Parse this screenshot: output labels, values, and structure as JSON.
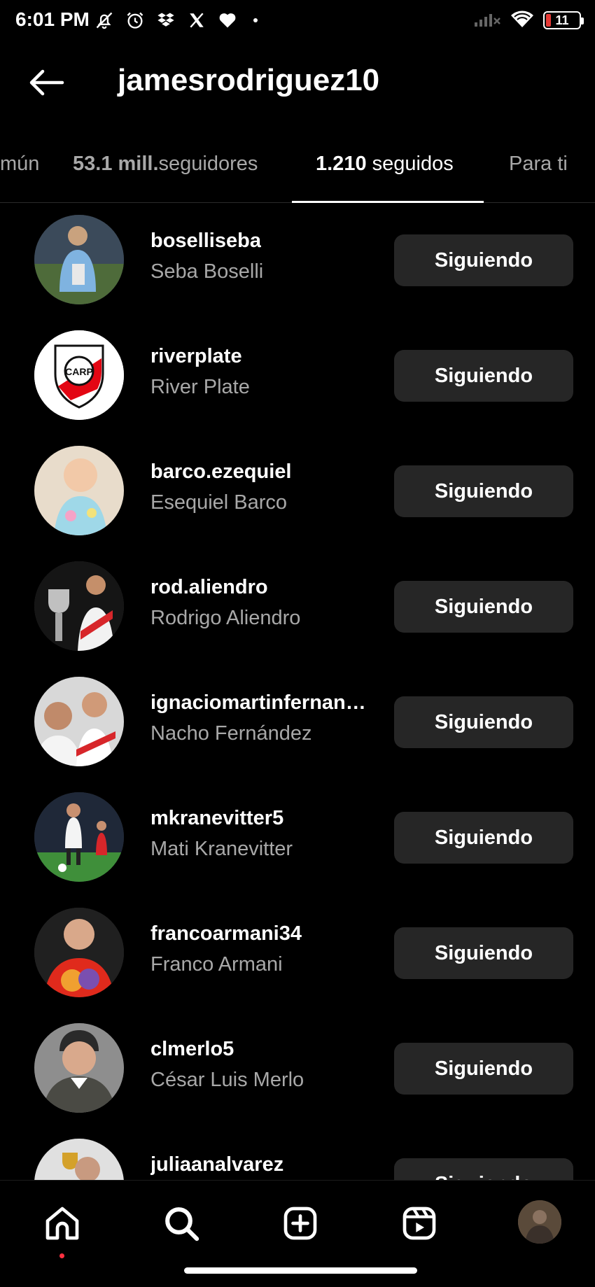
{
  "status_bar": {
    "time": "6:01 PM",
    "left_icons": [
      "mute-bell-icon",
      "alarm-icon",
      "dropbox-icon",
      "x-icon",
      "heart-icon"
    ],
    "battery": "11",
    "battery_color": "#e53935"
  },
  "header": {
    "back_icon": "arrow-left-icon",
    "title": "jamesrodriguez10"
  },
  "tabs": [
    {
      "label": "mún",
      "active": false
    },
    {
      "count": "53.1 mill.",
      "label": "seguidores",
      "active": false
    },
    {
      "count": "1.210",
      "label": "seguidos",
      "active": true
    },
    {
      "label": "Para ti",
      "active": false
    }
  ],
  "accounts": [
    {
      "username": "boselliseba",
      "fullname": "Seba Boselli",
      "button": "Siguiendo"
    },
    {
      "username": "riverplate",
      "fullname": "River Plate",
      "button": "Siguiendo"
    },
    {
      "username": "barco.ezequiel",
      "fullname": "Esequiel Barco",
      "button": "Siguiendo"
    },
    {
      "username": "rod.aliendro",
      "fullname": "Rodrigo Aliendro",
      "button": "Siguiendo"
    },
    {
      "username": "ignaciomartinfernan…",
      "fullname": "Nacho Fernández",
      "button": "Siguiendo"
    },
    {
      "username": "mkranevitter5",
      "fullname": "Mati Kranevitter",
      "button": "Siguiendo"
    },
    {
      "username": "francoarmani34",
      "fullname": "Franco Armani",
      "button": "Siguiendo"
    },
    {
      "username": "clmerlo5",
      "fullname": "César Luis Merlo",
      "button": "Siguiendo"
    },
    {
      "username": "juliaanalvarez",
      "fullname": "",
      "button": "Siguiendo"
    }
  ],
  "river_logo_text": "CARP",
  "bottom_nav": [
    "home-icon",
    "search-icon",
    "create-icon",
    "reels-icon",
    "profile-avatar"
  ],
  "colors": {
    "background": "#000000",
    "button_bg": "#262626",
    "secondary_text": "#a8a8a8",
    "notification_dot": "#ff3040"
  }
}
